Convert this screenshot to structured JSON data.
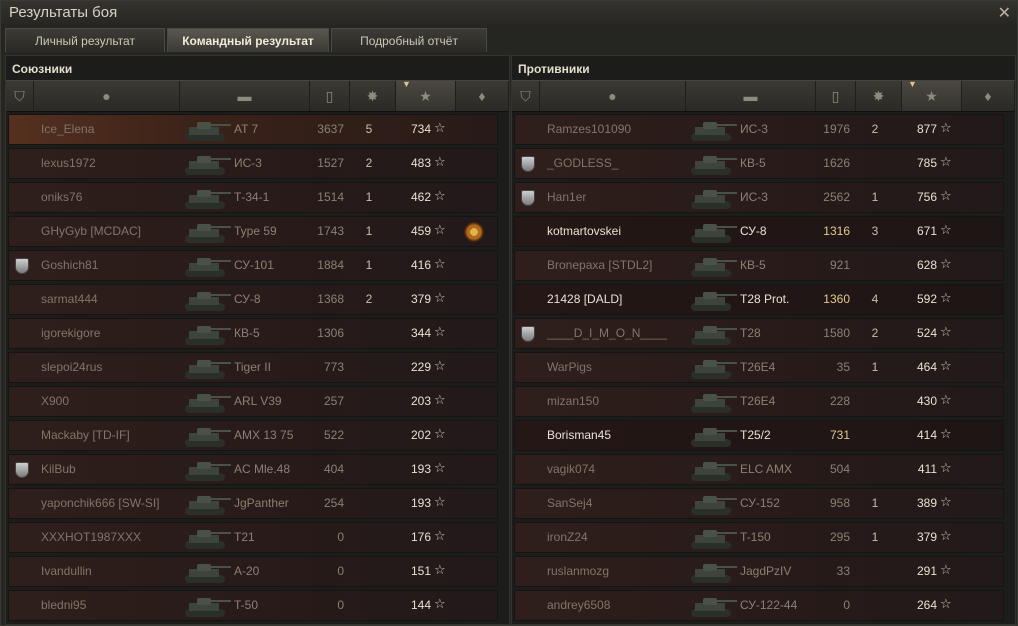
{
  "window": {
    "title": "Результаты боя",
    "close_icon": "close-icon"
  },
  "tabs": [
    {
      "label": "Личный результат"
    },
    {
      "label": "Командный результат"
    },
    {
      "label": "Подробный отчёт"
    }
  ],
  "allies": {
    "title": "Союзники",
    "columns": [
      "platoon-icon",
      "player-icon",
      "tank-icon",
      "damage-icon",
      "frags-icon",
      "xp-star-icon",
      "medal-icon"
    ],
    "rows": [
      {
        "name": "Ice_Elena",
        "tank": "AT 7",
        "damage": "3637",
        "kills": "5",
        "xp": "734",
        "badge": false,
        "medal": false,
        "self": true,
        "alive": false
      },
      {
        "name": "lexus1972",
        "tank": "ИС-3",
        "damage": "1527",
        "kills": "2",
        "xp": "483",
        "badge": false,
        "medal": false
      },
      {
        "name": "oniks76",
        "tank": "Т-34-1",
        "damage": "1514",
        "kills": "1",
        "xp": "462",
        "badge": false,
        "medal": false
      },
      {
        "name": "GHyGyb [MCDAC]",
        "tank": "Type 59",
        "damage": "1743",
        "kills": "1",
        "xp": "459",
        "badge": false,
        "medal": true
      },
      {
        "name": "Goshich81",
        "tank": "СУ-101",
        "damage": "1884",
        "kills": "1",
        "xp": "416",
        "badge": true,
        "medal": false
      },
      {
        "name": "sarmat444",
        "tank": "СУ-8",
        "damage": "1368",
        "kills": "2",
        "xp": "379",
        "badge": false,
        "medal": false
      },
      {
        "name": "igorekigore",
        "tank": "КВ-5",
        "damage": "1306",
        "kills": "",
        "xp": "344",
        "badge": false,
        "medal": false
      },
      {
        "name": "slepoi24rus",
        "tank": "Tiger II",
        "damage": "773",
        "kills": "",
        "xp": "229",
        "badge": false,
        "medal": false
      },
      {
        "name": "X900",
        "tank": "ARL V39",
        "damage": "257",
        "kills": "",
        "xp": "203",
        "badge": false,
        "medal": false
      },
      {
        "name": "Mackaby [TD-IF]",
        "tank": "AMX 13 75",
        "damage": "522",
        "kills": "",
        "xp": "202",
        "badge": false,
        "medal": false
      },
      {
        "name": "KilBub",
        "tank": "AC Mle.48",
        "damage": "404",
        "kills": "",
        "xp": "193",
        "badge": true,
        "medal": false
      },
      {
        "name": "yaponchik666 [SW-SI]",
        "tank": "JgPanther",
        "damage": "254",
        "kills": "",
        "xp": "193",
        "badge": false,
        "medal": false
      },
      {
        "name": "XXXHOT1987XXX",
        "tank": "T21",
        "damage": "0",
        "kills": "",
        "xp": "176",
        "badge": false,
        "medal": false
      },
      {
        "name": "Ivandullin",
        "tank": "A-20",
        "damage": "0",
        "kills": "",
        "xp": "151",
        "badge": false,
        "medal": false
      },
      {
        "name": "bledni95",
        "tank": "T-50",
        "damage": "0",
        "kills": "",
        "xp": "144",
        "badge": false,
        "medal": false
      }
    ]
  },
  "enemies": {
    "title": "Противники",
    "rows": [
      {
        "name": "Ramzes101090",
        "tank": "ИС-3",
        "damage": "1976",
        "kills": "2",
        "xp": "877",
        "badge": false,
        "alive": false
      },
      {
        "name": "_GODLESS_",
        "tank": "КВ-5",
        "damage": "1626",
        "kills": "",
        "xp": "785",
        "badge": true,
        "alive": false
      },
      {
        "name": "Han1er",
        "tank": "ИС-3",
        "damage": "2562",
        "kills": "1",
        "xp": "756",
        "badge": true,
        "alive": false
      },
      {
        "name": "kotmartovskei",
        "tank": "СУ-8",
        "damage": "1316",
        "kills": "3",
        "xp": "671",
        "badge": false,
        "alive": true
      },
      {
        "name": "Bronepaxa [STDL2]",
        "tank": "КВ-5",
        "damage": "921",
        "kills": "",
        "xp": "628",
        "badge": false,
        "alive": false
      },
      {
        "name": "21428 [DALD]",
        "tank": "T28 Prot.",
        "damage": "1360",
        "kills": "4",
        "xp": "592",
        "badge": false,
        "alive": true
      },
      {
        "name": "____D_I_M_O_N____",
        "tank": "T28",
        "damage": "1580",
        "kills": "2",
        "xp": "524",
        "badge": true,
        "alive": false
      },
      {
        "name": "WarPigs",
        "tank": "T26E4",
        "damage": "35",
        "kills": "1",
        "xp": "464",
        "badge": false,
        "alive": false
      },
      {
        "name": "mizan150",
        "tank": "T26E4",
        "damage": "228",
        "kills": "",
        "xp": "430",
        "badge": false,
        "alive": false
      },
      {
        "name": "Borisman45",
        "tank": "T25/2",
        "damage": "731",
        "kills": "",
        "xp": "414",
        "badge": false,
        "alive": true
      },
      {
        "name": "vagik074",
        "tank": "ELC AMX",
        "damage": "504",
        "kills": "",
        "xp": "411",
        "badge": false,
        "alive": false
      },
      {
        "name": "SanSej4",
        "tank": "СУ-152",
        "damage": "958",
        "kills": "1",
        "xp": "389",
        "badge": false,
        "alive": false
      },
      {
        "name": "ironZ24",
        "tank": "T-150",
        "damage": "295",
        "kills": "1",
        "xp": "379",
        "badge": false,
        "alive": false
      },
      {
        "name": "ruslanmozg",
        "tank": "JagdPzIV",
        "damage": "33",
        "kills": "",
        "xp": "291",
        "badge": false,
        "alive": false
      },
      {
        "name": "andrey6508",
        "tank": "СУ-122-44",
        "damage": "0",
        "kills": "",
        "xp": "264",
        "badge": false,
        "alive": false
      }
    ]
  }
}
